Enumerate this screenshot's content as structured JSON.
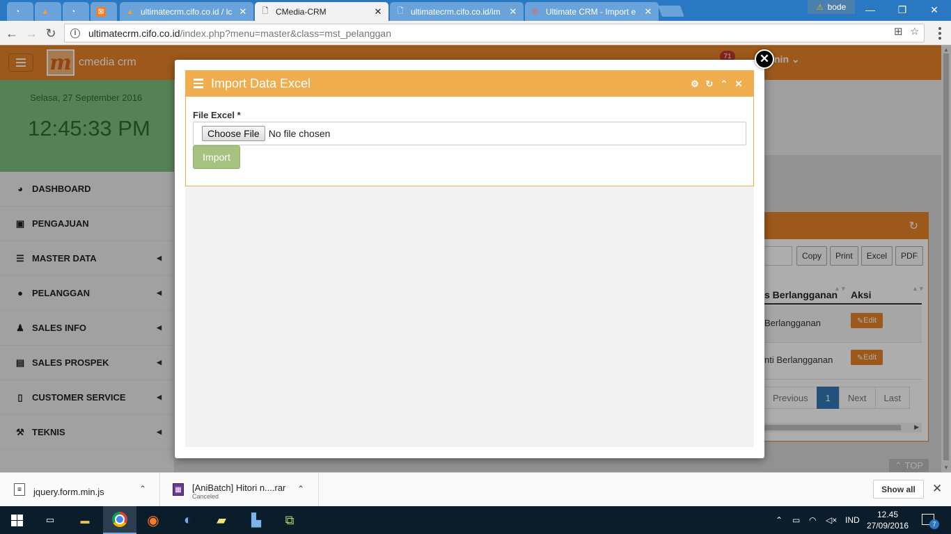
{
  "browser": {
    "tabs": [
      {
        "title": "",
        "icon": "gauge-icon"
      },
      {
        "title": "",
        "icon": "pma-icon"
      },
      {
        "title": "",
        "icon": "gauge-icon"
      },
      {
        "title": "",
        "icon": "xampp-icon"
      },
      {
        "title": "ultimatecrm.cifo.co.id / lc",
        "icon": "pma-icon"
      },
      {
        "title": "CMedia-CRM",
        "icon": "page-icon",
        "active": true
      },
      {
        "title": "ultimatecrm.cifo.co.id/im",
        "icon": "page-icon"
      },
      {
        "title": "Ultimate CRM - Import e",
        "icon": "app-icon"
      }
    ],
    "profile_name": "bode",
    "url_host": "ultimatecrm.cifo.co.id",
    "url_path": "/index.php?menu=master&class=mst_pelanggan"
  },
  "header": {
    "brand": "cmedia crm",
    "notification_count": "71",
    "user_label": "nin"
  },
  "datebox": {
    "date": "Selasa, 27 September 2016",
    "time": "12:45:33 PM"
  },
  "sidebar": {
    "items": [
      {
        "label": "DASHBOARD",
        "icon": "dashboard-icon"
      },
      {
        "label": "PENGAJUAN",
        "icon": "money-icon"
      },
      {
        "label": "MASTER DATA",
        "icon": "list-icon"
      },
      {
        "label": "PELANGGAN",
        "icon": "user-icon"
      },
      {
        "label": "SALES INFO",
        "icon": "person-icon"
      },
      {
        "label": "SALES PROSPEK",
        "icon": "book-icon"
      },
      {
        "label": "CUSTOMER SERVICE",
        "icon": "phone-icon"
      },
      {
        "label": "TEKNIS",
        "icon": "wrench-icon"
      }
    ]
  },
  "table": {
    "buttons": [
      "Copy",
      "Print",
      "Excel",
      "PDF"
    ],
    "columns": [
      "s Berlangganan",
      "Aksi"
    ],
    "rows": [
      {
        "status": "Berlangganan",
        "action": "Edit"
      },
      {
        "status": "nti Berlangganan",
        "action": "Edit"
      }
    ],
    "pager": [
      "Previous",
      "1",
      "Next",
      "Last"
    ],
    "to_top": "TOP"
  },
  "modal": {
    "title": "Import Data Excel",
    "field_label": "File Excel *",
    "choose_file": "Choose File",
    "no_file": "No file chosen",
    "import_button": "Import"
  },
  "downloads": [
    {
      "name": "jquery.form.min.js",
      "status": ""
    },
    {
      "name": "[AniBatch] Hitori n....rar",
      "status": "Canceled"
    }
  ],
  "shelf": {
    "show_all": "Show all"
  },
  "taskbar": {
    "lang": "IND",
    "time": "12.45",
    "date": "27/09/2016",
    "notifications": "7"
  },
  "colors": {
    "accent_orange": "#e8832a",
    "modal_header": "#f0ad4e",
    "import_button": "#a5c27e",
    "chrome_blue": "#2b78c2"
  }
}
